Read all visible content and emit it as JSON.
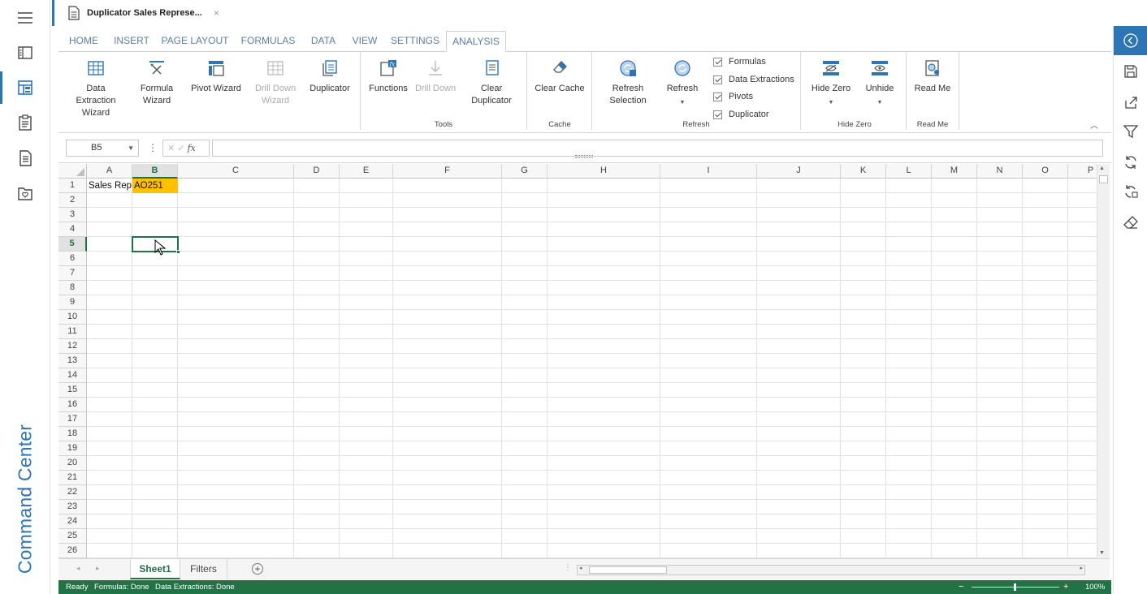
{
  "doc_tab": {
    "title": "Duplicator Sales Represe...",
    "close": "×"
  },
  "nav": {
    "command_center": "Command Center"
  },
  "ribbon_tabs": [
    "HOME",
    "INSERT",
    "PAGE LAYOUT",
    "FORMULAS",
    "DATA",
    "VIEW",
    "SETTINGS",
    "ANALYSIS"
  ],
  "active_tab": "ANALYSIS",
  "ribbon": {
    "data_extraction_wizard": [
      "Data",
      "Extraction",
      "Wizard"
    ],
    "formula_wizard": [
      "Formula",
      "Wizard"
    ],
    "pivot_wizard": "Pivot Wizard",
    "drill_down_wizard": [
      "Drill Down",
      "Wizard"
    ],
    "duplicator": "Duplicator",
    "functions": "Functions",
    "drill_down": "Drill Down",
    "clear_duplicator": [
      "Clear",
      "Duplicator"
    ],
    "tools_group": "Tools",
    "clear_cache": "Clear Cache",
    "cache_group": "Cache",
    "refresh_selection": [
      "Refresh",
      "Selection"
    ],
    "refresh": "Refresh",
    "checks": [
      "Formulas",
      "Data Extractions",
      "Pivots",
      "Duplicator"
    ],
    "refresh_group": "Refresh",
    "hide_zero": "Hide Zero",
    "unhide": "Unhide",
    "hide_zero_group": "Hide Zero",
    "read_me": "Read Me",
    "read_me_group": "Read Me"
  },
  "formula_bar": {
    "name_box": "B5",
    "formula": ""
  },
  "columns": [
    "A",
    "B",
    "C",
    "D",
    "E",
    "F",
    "G",
    "H",
    "I",
    "J",
    "K",
    "L",
    "M",
    "N",
    "O",
    "P"
  ],
  "selected_column": "B",
  "rows": [
    "1",
    "2",
    "3",
    "4",
    "5",
    "6",
    "7",
    "8",
    "9",
    "10",
    "11",
    "12",
    "13",
    "14",
    "15",
    "16",
    "17",
    "18",
    "19",
    "20",
    "21",
    "22",
    "23",
    "24",
    "25",
    "26"
  ],
  "selected_row": "5",
  "cells": {
    "A1": "Sales Rep",
    "B1": "AO251"
  },
  "colors": {
    "accent": "#2e75b6",
    "excel_green": "#217346",
    "highlight": "#ffc000"
  },
  "sheets": [
    "Sheet1",
    "Filters"
  ],
  "active_sheet": "Sheet1",
  "status": {
    "ready": "Ready",
    "formulas": "Formulas: Done",
    "extractions": "Data Extractions: Done",
    "zoom": "100%"
  }
}
